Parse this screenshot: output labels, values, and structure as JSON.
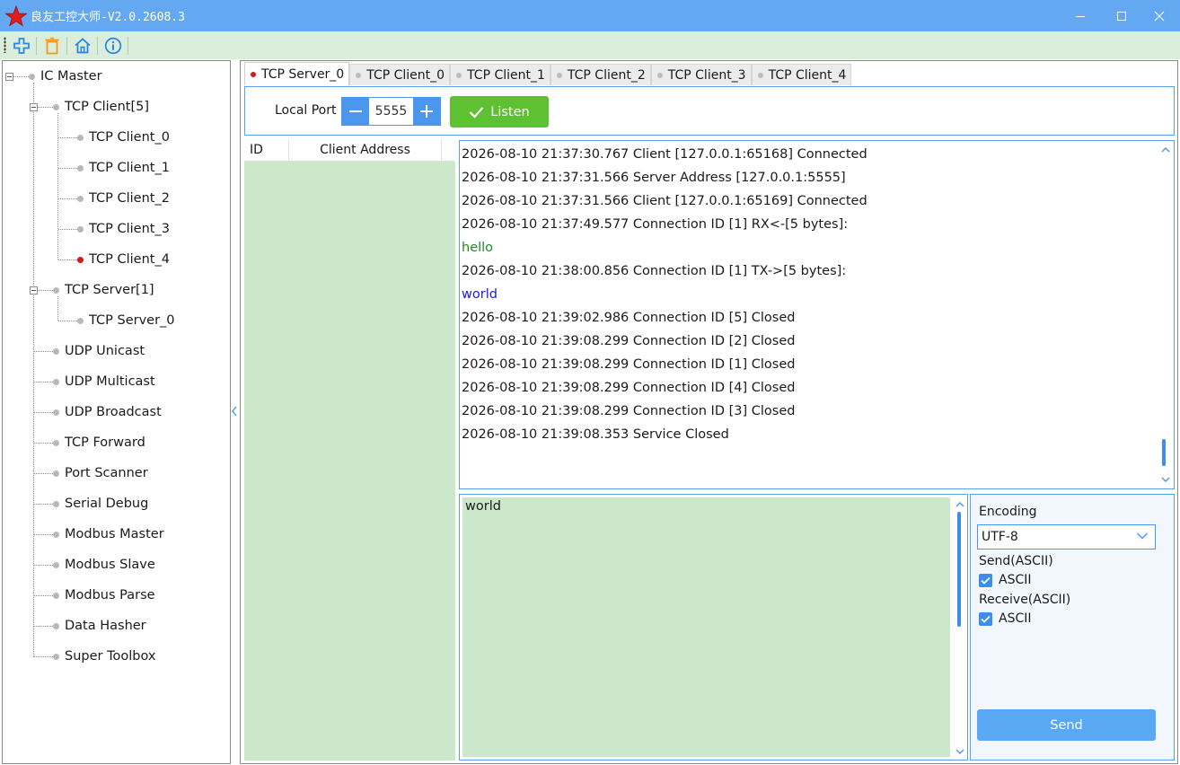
{
  "window": {
    "title": "良友工控大师-V2.0.2608.3",
    "minimize_icon": "minimize-icon",
    "maximize_icon": "maximize-icon",
    "close_icon": "close-icon"
  },
  "toolbar": {
    "icons": [
      "add-icon",
      "delete-icon",
      "home-icon",
      "info-icon"
    ]
  },
  "sidebar": {
    "root": "IC Master",
    "tcp_client_group": "TCP Client[5]",
    "tcp_clients": [
      "TCP Client_0",
      "TCP Client_1",
      "TCP Client_2",
      "TCP Client_3",
      "TCP Client_4"
    ],
    "tcp_server_group": "TCP Server[1]",
    "tcp_servers": [
      "TCP Server_0"
    ],
    "tools": [
      "UDP Unicast",
      "UDP Multicast",
      "UDP Broadcast",
      "TCP Forward",
      "Port Scanner",
      "Serial Debug",
      "Modbus Master",
      "Modbus Slave",
      "Modbus Parse",
      "Data Hasher",
      "Super Toolbox"
    ]
  },
  "tabs": [
    "TCP Server_0",
    "TCP Client_0",
    "TCP Client_1",
    "TCP Client_2",
    "TCP Client_3",
    "TCP Client_4"
  ],
  "active_tab": "TCP Server_0",
  "port_bar": {
    "label": "Local Port",
    "port": "5555",
    "listen_label": "Listen"
  },
  "client_table": {
    "columns": [
      "ID",
      "Client Address"
    ],
    "rows": []
  },
  "log": [
    {
      "text": "2026-08-10 21:37:30.767 Client [127.0.0.1:65168] Connected",
      "kind": "info"
    },
    {
      "text": "2026-08-10 21:37:31.566 Server Address [127.0.0.1:5555]",
      "kind": "info"
    },
    {
      "text": "2026-08-10 21:37:31.566 Client [127.0.0.1:65169] Connected",
      "kind": "info"
    },
    {
      "text": "2026-08-10 21:37:49.577 Connection ID [1] RX<-[5 bytes]:",
      "kind": "info"
    },
    {
      "text": "hello",
      "kind": "rx"
    },
    {
      "text": "2026-08-10 21:38:00.856 Connection ID [1] TX->[5 bytes]:",
      "kind": "info"
    },
    {
      "text": "world",
      "kind": "tx"
    },
    {
      "text": "2026-08-10 21:39:02.986 Connection ID [5] Closed",
      "kind": "info"
    },
    {
      "text": "2026-08-10 21:39:08.299 Connection ID [2] Closed",
      "kind": "info"
    },
    {
      "text": "2026-08-10 21:39:08.299 Connection ID [1] Closed",
      "kind": "info"
    },
    {
      "text": "2026-08-10 21:39:08.299 Connection ID [4] Closed",
      "kind": "info"
    },
    {
      "text": "2026-08-10 21:39:08.299 Connection ID [3] Closed",
      "kind": "info"
    },
    {
      "text": "2026-08-10 21:39:08.353 Service Closed",
      "kind": "info"
    }
  ],
  "send": {
    "text": "world"
  },
  "settings": {
    "encoding_label": "Encoding",
    "encoding_value": "UTF-8",
    "send_label": "Send(ASCII)",
    "send_ascii_label": "ASCII",
    "send_ascii_checked": true,
    "receive_label": "Receive(ASCII)",
    "receive_ascii_label": "ASCII",
    "receive_ascii_checked": true,
    "send_button": "Send"
  },
  "colors": {
    "titlebar": "#64a8f2",
    "toolbar": "#dbeedb",
    "accent": "#4b97ee",
    "listen": "#5ec132",
    "panel_green": "#cbe8cb",
    "rx_text": "#1f8a1f",
    "tx_text": "#1a1ae6",
    "active_dot": "#d61a1a"
  }
}
